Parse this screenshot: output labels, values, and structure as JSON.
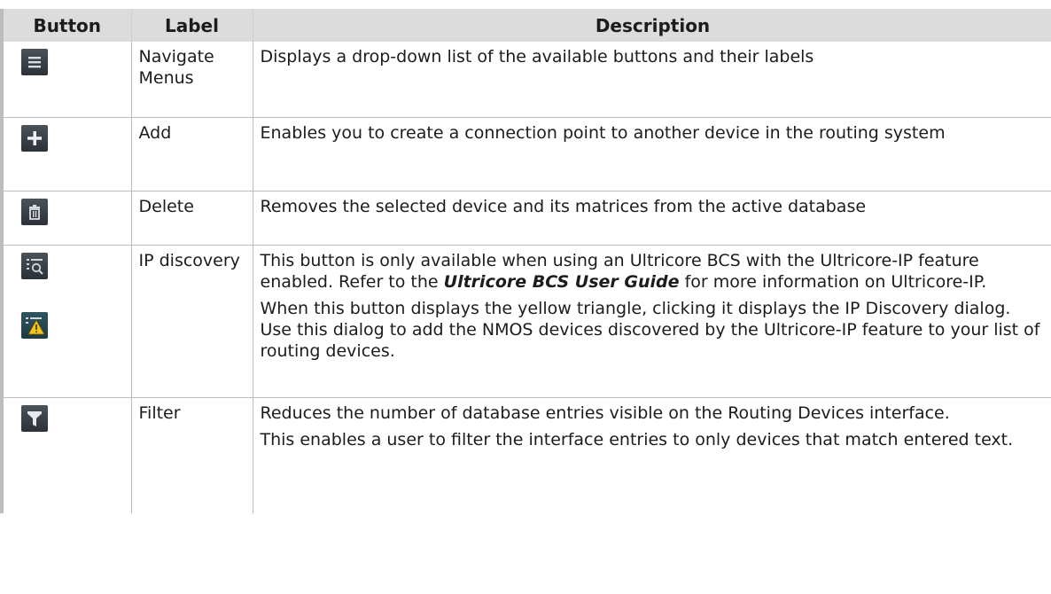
{
  "table": {
    "headers": {
      "button": "Button",
      "label": "Label",
      "description": "Description"
    },
    "rows": [
      {
        "icon": "hamburger-menu-icon",
        "label": "Navigate Menus",
        "description": "Displays a drop-down list of the available buttons and their labels"
      },
      {
        "icon": "plus-icon",
        "label": "Add",
        "description": "Enables you to create a connection point to another device in the routing system"
      },
      {
        "icon": "trash-icon",
        "label": "Delete",
        "description": "Removes the selected device and its matrices from the active database"
      },
      {
        "icon": "ip-discovery-icon",
        "icon_alt": "ip-discovery-warning-icon",
        "label": "IP discovery",
        "desc_p1_before": "This button is only available when using an Ultricore BCS with the Ultricore-IP feature enabled. Refer to the ",
        "desc_p1_doc": "Ultricore BCS User Guide",
        "desc_p1_after": " for more information on Ultricore-IP.",
        "desc_p2": "When this button displays the yellow triangle, clicking it displays the IP Discovery dialog. Use this dialog to add the NMOS devices discovered by the Ultricore-IP feature to your list of routing devices."
      },
      {
        "icon": "filter-icon",
        "label": "Filter",
        "desc_p1": "Reduces the number of database entries visible on the Routing Devices interface.",
        "desc_p2": "This enables a user to filter the interface entries to only devices that match entered text."
      }
    ]
  }
}
